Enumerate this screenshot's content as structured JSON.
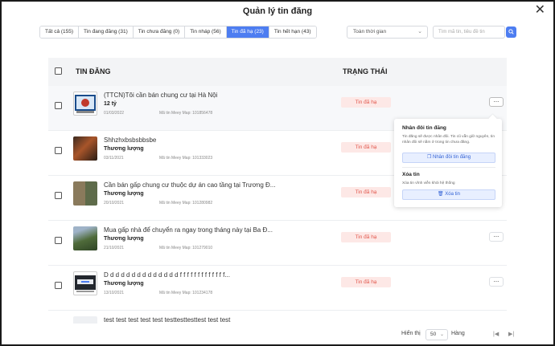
{
  "modal": {
    "title": "Quản lý tin đăng",
    "close_glyph": "✕"
  },
  "tabs": [
    {
      "label": "Tất cả (155)",
      "active": false
    },
    {
      "label": "Tin đang đăng (31)",
      "active": false
    },
    {
      "label": "Tin chưa đăng (0)",
      "active": false
    },
    {
      "label": "Tin nháp (56)",
      "active": false
    },
    {
      "label": "Tin đã hạ (23)",
      "active": true
    },
    {
      "label": "Tin hết hạn (43)",
      "active": false
    }
  ],
  "filters": {
    "time_value": "Toàn thời gian",
    "search_placeholder": "Tìm mã tin, tiêu đề tin"
  },
  "table": {
    "headers": {
      "title": "TIN ĐĂNG",
      "status": "TRẠNG THÁI"
    },
    "rows": [
      {
        "title": "(TTCN)Tôi cần bán chung cư tại Hà Nội",
        "price": "12 tỷ",
        "date": "01/03/2022",
        "code": "Mã tin Meey Map: 101856478",
        "status": "Tin đã hạ",
        "thumb": "thumb-screen-red"
      },
      {
        "title": "Shhzhxbsbsbbsbe",
        "price": "Thương lượng",
        "date": "03/11/2021",
        "code": "Mã tin Meey Map: 101333023",
        "status": "Tin đã hạ",
        "thumb": "thumb-night-scene"
      },
      {
        "title": "Cần bán gấp chung cư thuộc dự án cao tầng tại Trương Đ...",
        "price": "Thương lượng",
        "date": "20/10/2021",
        "code": "Mã tin Meey Map: 101280982",
        "status": "Tin đã hạ",
        "thumb": "thumb-house-collage"
      },
      {
        "title": "Mua gấp nhà để chuyển ra ngay trong tháng này tại Ba Đ...",
        "price": "Thương lượng",
        "date": "21/10/2021",
        "code": "Mã tin Meey Map: 101279010",
        "status": "Tin đã hạ",
        "thumb": "thumb-trees"
      },
      {
        "title": "D d d d d d d d d d d d d d f f f f f f f f f f f f f...",
        "price": "Thương lượng",
        "date": "13/10/2021",
        "code": "Mã tin Meey Map: 101234178",
        "status": "Tin đã hạ",
        "thumb": "thumb-screen-dark"
      },
      {
        "title": "test test test test test testtesttesttest test test",
        "price": "",
        "date": "",
        "code": "",
        "status": "",
        "thumb": "thumb-plain"
      }
    ]
  },
  "popup": {
    "duplicate_heading": "Nhân đôi tin đăng",
    "duplicate_desc": "Tin đăng sẽ được nhân đôi. Tin cũ vẫn giữ nguyên, tin nhân đôi sẽ nằm ở trong tin chưa đăng.",
    "duplicate_button": "Nhân đôi tin đăng",
    "delete_heading": "Xóa tin",
    "delete_desc": "Xóa tin vĩnh viễn khỏi hệ thống",
    "delete_button": "Xóa tin"
  },
  "footer": {
    "show_label": "Hiển thị",
    "page_size": "50",
    "rows_label": "Hàng"
  },
  "colors": {
    "accent": "#4d7df1",
    "badge_bg": "#fde8e6",
    "badge_text": "#e2574c"
  }
}
